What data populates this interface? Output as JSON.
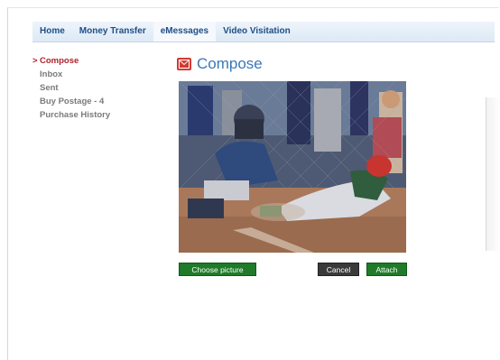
{
  "nav": {
    "tabs": [
      {
        "label": "Home"
      },
      {
        "label": "Money Transfer"
      },
      {
        "label": "eMessages"
      },
      {
        "label": "Video Visitation"
      }
    ]
  },
  "sidebar": {
    "items": [
      {
        "label": "Compose",
        "active": true
      },
      {
        "label": "Inbox"
      },
      {
        "label": "Sent"
      },
      {
        "label": "Buy Postage - 4"
      },
      {
        "label": "Purchase History"
      }
    ],
    "active_marker": ">"
  },
  "compose": {
    "title": "Compose",
    "icon": "envelope-icon"
  },
  "photo": {
    "description_icon": "photo"
  },
  "buttons": {
    "choose_picture": "Choose picture",
    "cancel": "Cancel",
    "attach": "Attach"
  },
  "colors": {
    "nav_text": "#1d4f86",
    "active_red": "#b0222c",
    "title_blue": "#3a78b8",
    "green_button": "#1f7a2a",
    "dark_button": "#3a3a3a"
  }
}
